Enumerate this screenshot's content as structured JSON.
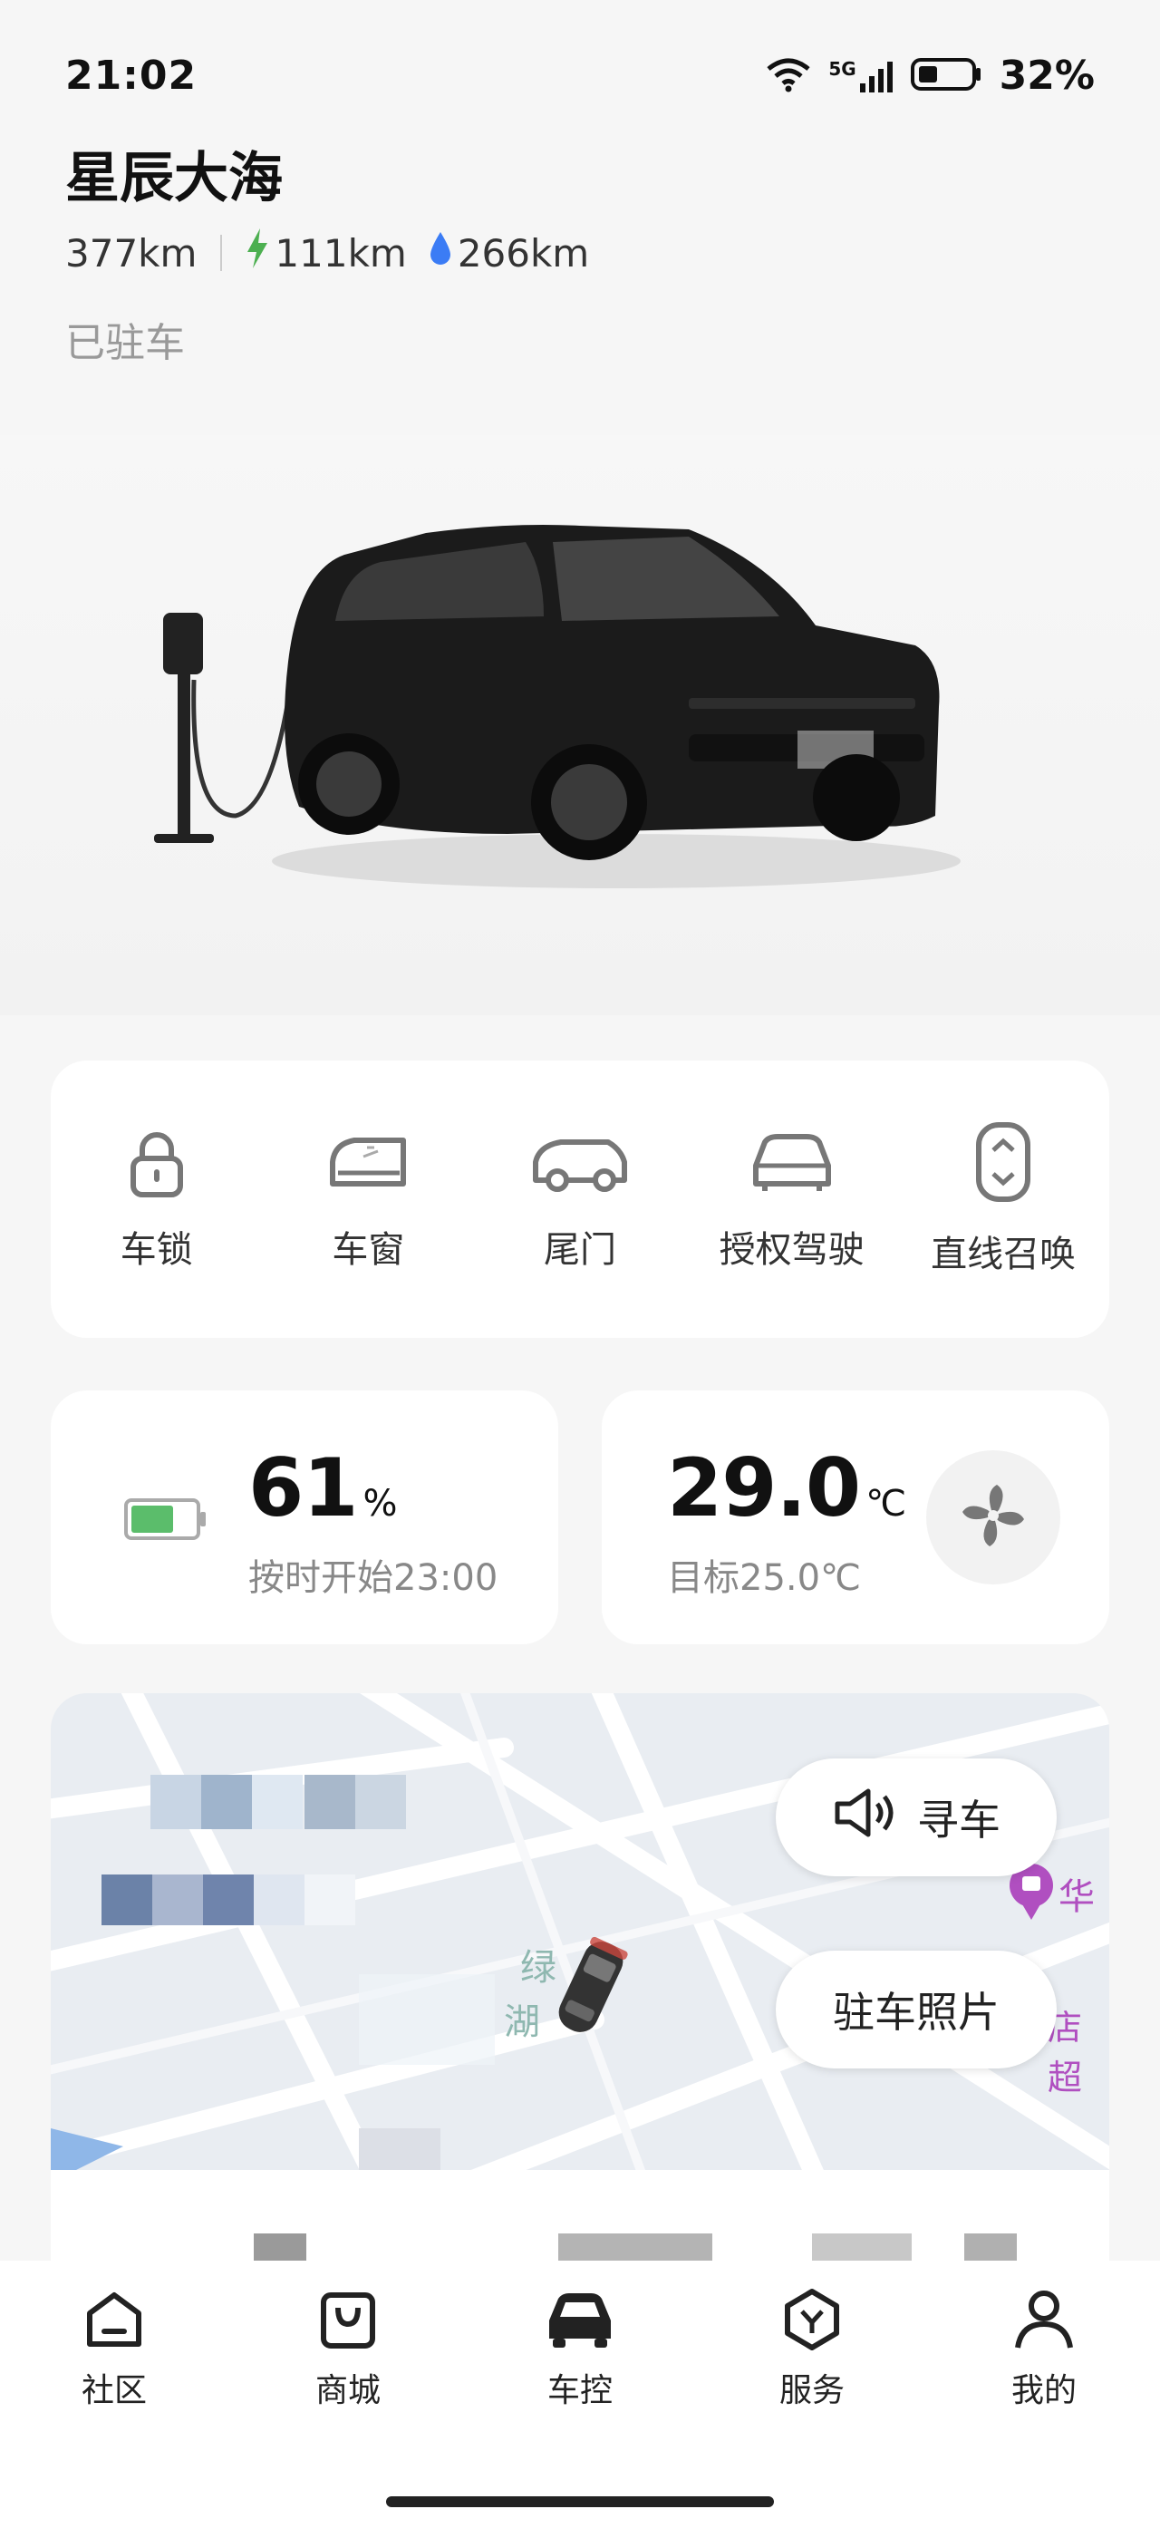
{
  "status": {
    "time": "21:02",
    "network": "5G",
    "battery": "32%"
  },
  "vehicle": {
    "name": "星辰大海",
    "total_range": "377km",
    "electric_range": "111km",
    "fuel_range": "266km",
    "state": "已驻车"
  },
  "controls": [
    {
      "label": "车锁",
      "icon": "lock-icon"
    },
    {
      "label": "车窗",
      "icon": "window-icon"
    },
    {
      "label": "尾门",
      "icon": "tailgate-icon"
    },
    {
      "label": "授权驾驶",
      "icon": "authorized-drive-icon"
    },
    {
      "label": "直线召唤",
      "icon": "summon-icon"
    }
  ],
  "battery": {
    "percent": "61",
    "unit": "%",
    "level": 0.61,
    "schedule": "按时开始23:00"
  },
  "climate": {
    "temp": "29.0",
    "unit": "℃",
    "target": "目标25.0℃"
  },
  "map": {
    "find_car": "寻车",
    "park_photo": "驻车照片",
    "poi_label": "华",
    "poi_label2": "店超",
    "street_fragment": "绿",
    "street_fragment2": "湖"
  },
  "nav": [
    {
      "label": "社区",
      "icon": "community-icon"
    },
    {
      "label": "商城",
      "icon": "shop-icon"
    },
    {
      "label": "车控",
      "icon": "car-control-icon",
      "active": true
    },
    {
      "label": "服务",
      "icon": "service-icon"
    },
    {
      "label": "我的",
      "icon": "profile-icon"
    }
  ],
  "colors": {
    "accent_green": "#4caf50",
    "fuel_blue": "#3b7cf5",
    "poi_purple": "#b04fc0"
  }
}
